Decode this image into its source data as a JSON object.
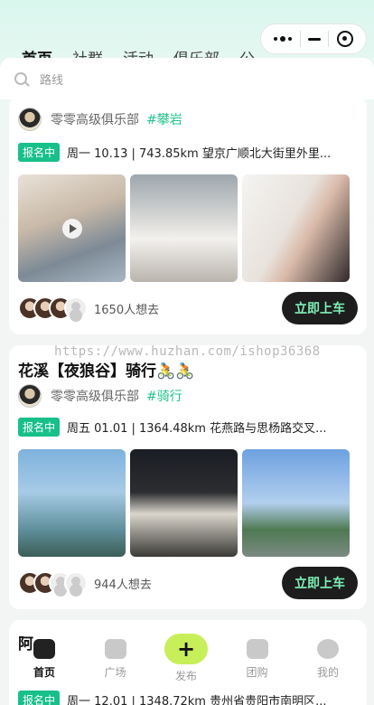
{
  "capsule": {
    "more_icon": "dots-icon",
    "minimize_icon": "minus-icon",
    "close_icon": "target-icon"
  },
  "top_tabs": [
    "首页",
    "社群",
    "活动",
    "俱乐部",
    "公"
  ],
  "search": {
    "placeholder": "路线"
  },
  "cards": [
    {
      "club": {
        "name": "零零高级俱乐部",
        "tag": "#攀岩"
      },
      "badge": "报名中",
      "info": "周一 10.13 | 743.85km 望京广顺北大街里外里...",
      "want": "1650人想去",
      "join": "立即上车"
    },
    {
      "title": "花溪【夜狼谷】骑行🚴🚴",
      "club": {
        "name": "零零高级俱乐部",
        "tag": "#骑行"
      },
      "badge": "报名中",
      "info": "周五 01.01 | 1364.48km 花燕路与思杨路交叉...",
      "want": "944人想去",
      "join": "立即上车"
    },
    {
      "title": "阿",
      "badge": "报名中",
      "info": "周一 12.01 | 1348.72km 贵州省贵阳市南明区..."
    }
  ],
  "watermark": "https://www.huzhan.com/ishop36368",
  "tabbar": [
    {
      "label": "首页",
      "icon": "home-icon"
    },
    {
      "label": "广场",
      "icon": "plaza-icon"
    },
    {
      "label": "发布",
      "icon": "plus-icon"
    },
    {
      "label": "团购",
      "icon": "group-buy-icon"
    },
    {
      "label": "我的",
      "icon": "profile-icon"
    }
  ],
  "colors": {
    "accent": "#17c089",
    "button_bg": "#1d1d1d",
    "button_text": "#7ef0b8",
    "publish": "#c7ef5a"
  }
}
